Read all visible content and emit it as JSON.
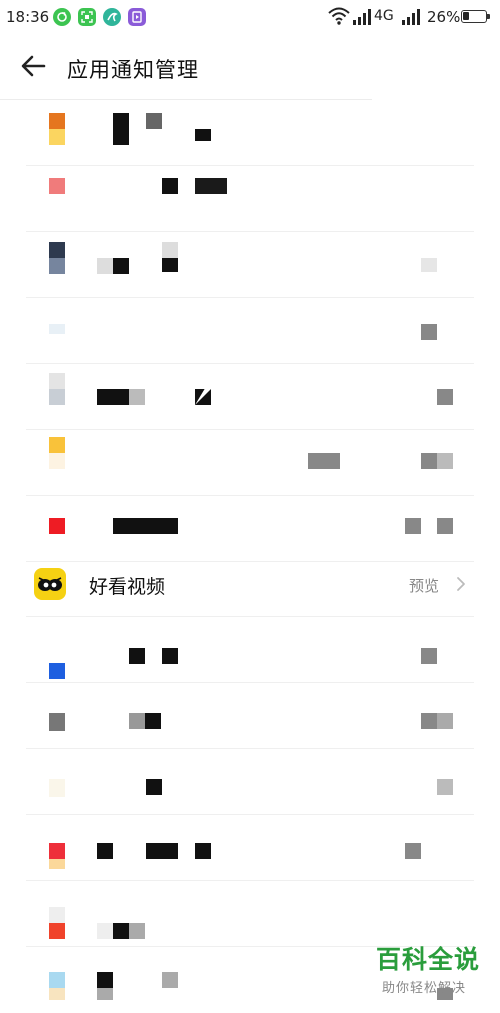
{
  "status_bar": {
    "time": "18:36",
    "network": "4G",
    "battery_percent": "26%",
    "notification_icons": [
      "refresh-app-icon",
      "scan-app-icon",
      "browser-app-icon",
      "video-app-icon"
    ]
  },
  "header": {
    "title": "应用通知管理",
    "back_icon": "arrow-left-icon"
  },
  "featured_app": {
    "name": "好看视频",
    "preview_label": "预览",
    "icon": "haokan-eyes-icon",
    "icon_color": "#f5d113"
  },
  "watermark": {
    "title": "百科全说",
    "subtitle": "助你轻松解决",
    "color": "#2a9d3c"
  },
  "colors": {
    "accent_green": "#3cc451",
    "text_primary": "#111111",
    "text_secondary": "#888888"
  }
}
